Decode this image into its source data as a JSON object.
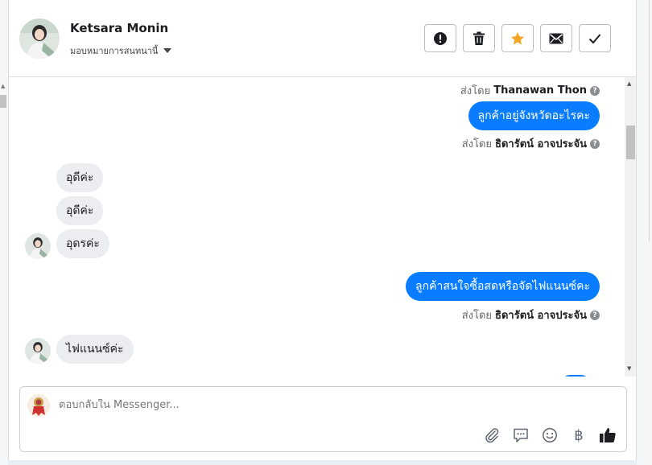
{
  "contact": {
    "name": "Ketsara Monin",
    "assign_label": "มอบหมายการสนทนานี้"
  },
  "actions": [
    "report-icon",
    "trash-icon",
    "star-icon",
    "mail-icon",
    "check-icon"
  ],
  "colors": {
    "accent": "#0a7cff",
    "star": "#f5a623",
    "incoming_bg": "#ebedf0"
  },
  "thread": {
    "sent_by_prefix": "ส่งโดย",
    "agent1": "Thanawan Thon",
    "agent2": "ธิดารัตน์ อาจประจัน",
    "msg1": "ลูกค้าอยู่จังหวัดอะไรคะ",
    "msg2": "อุดีค่ะ",
    "msg3": "อุดีค่ะ",
    "msg4": "อุดรค่ะ",
    "msg5": "ลูกค้าสนใจซื้อสดหรือจัดไฟแนนซ์คะ",
    "msg6": "ไฟแนนซ์ค่ะ",
    "help_glyph": "?"
  },
  "composer": {
    "placeholder": "ตอบกลับใน Messenger...",
    "tools": [
      "attach-icon",
      "saved-reply-icon",
      "emoji-icon",
      "baht-icon",
      "like-icon"
    ],
    "baht": "฿"
  }
}
